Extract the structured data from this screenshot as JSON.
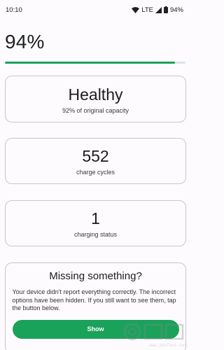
{
  "status_bar": {
    "time": "10:10",
    "network": "LTE",
    "battery": "94%"
  },
  "battery": {
    "percent_text": "94%",
    "level": 0.94,
    "accent_color": "#1aa25a"
  },
  "cards": {
    "health": {
      "value": "Healthy",
      "label": "92% of original capacity"
    },
    "cycles": {
      "value": "552",
      "label": "charge cycles"
    },
    "status": {
      "value": "1",
      "label": "charging status"
    }
  },
  "missing": {
    "title": "Missing something?",
    "description": "Your device didn't report everything correctly. The incorrect options have been hidden. If you still want to see them, tap the button below.",
    "button_label": "Show"
  },
  "watermark": {
    "text": "www.yesfans.net"
  }
}
